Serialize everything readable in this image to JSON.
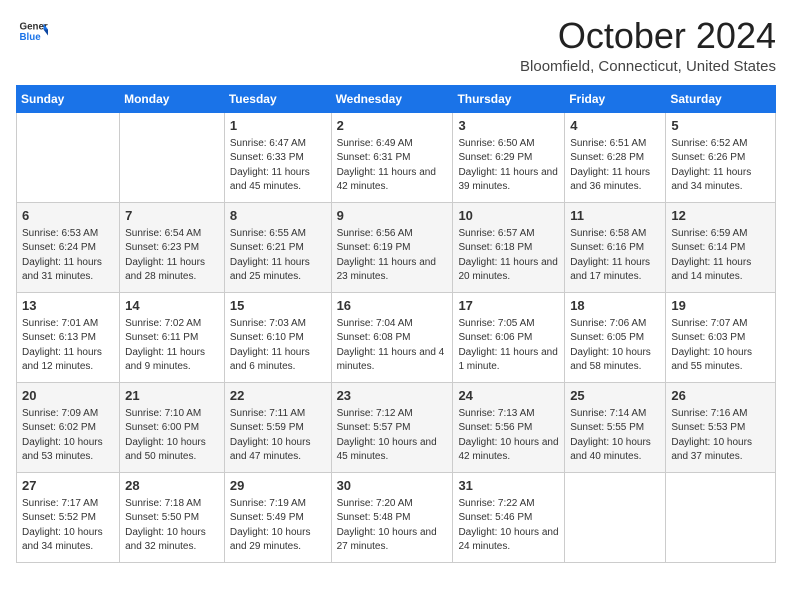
{
  "header": {
    "logo_general": "General",
    "logo_blue": "Blue",
    "month_title": "October 2024",
    "location": "Bloomfield, Connecticut, United States"
  },
  "days_of_week": [
    "Sunday",
    "Monday",
    "Tuesday",
    "Wednesday",
    "Thursday",
    "Friday",
    "Saturday"
  ],
  "weeks": [
    [
      {
        "day": "",
        "info": ""
      },
      {
        "day": "",
        "info": ""
      },
      {
        "day": "1",
        "info": "Sunrise: 6:47 AM\nSunset: 6:33 PM\nDaylight: 11 hours and 45 minutes."
      },
      {
        "day": "2",
        "info": "Sunrise: 6:49 AM\nSunset: 6:31 PM\nDaylight: 11 hours and 42 minutes."
      },
      {
        "day": "3",
        "info": "Sunrise: 6:50 AM\nSunset: 6:29 PM\nDaylight: 11 hours and 39 minutes."
      },
      {
        "day": "4",
        "info": "Sunrise: 6:51 AM\nSunset: 6:28 PM\nDaylight: 11 hours and 36 minutes."
      },
      {
        "day": "5",
        "info": "Sunrise: 6:52 AM\nSunset: 6:26 PM\nDaylight: 11 hours and 34 minutes."
      }
    ],
    [
      {
        "day": "6",
        "info": "Sunrise: 6:53 AM\nSunset: 6:24 PM\nDaylight: 11 hours and 31 minutes."
      },
      {
        "day": "7",
        "info": "Sunrise: 6:54 AM\nSunset: 6:23 PM\nDaylight: 11 hours and 28 minutes."
      },
      {
        "day": "8",
        "info": "Sunrise: 6:55 AM\nSunset: 6:21 PM\nDaylight: 11 hours and 25 minutes."
      },
      {
        "day": "9",
        "info": "Sunrise: 6:56 AM\nSunset: 6:19 PM\nDaylight: 11 hours and 23 minutes."
      },
      {
        "day": "10",
        "info": "Sunrise: 6:57 AM\nSunset: 6:18 PM\nDaylight: 11 hours and 20 minutes."
      },
      {
        "day": "11",
        "info": "Sunrise: 6:58 AM\nSunset: 6:16 PM\nDaylight: 11 hours and 17 minutes."
      },
      {
        "day": "12",
        "info": "Sunrise: 6:59 AM\nSunset: 6:14 PM\nDaylight: 11 hours and 14 minutes."
      }
    ],
    [
      {
        "day": "13",
        "info": "Sunrise: 7:01 AM\nSunset: 6:13 PM\nDaylight: 11 hours and 12 minutes."
      },
      {
        "day": "14",
        "info": "Sunrise: 7:02 AM\nSunset: 6:11 PM\nDaylight: 11 hours and 9 minutes."
      },
      {
        "day": "15",
        "info": "Sunrise: 7:03 AM\nSunset: 6:10 PM\nDaylight: 11 hours and 6 minutes."
      },
      {
        "day": "16",
        "info": "Sunrise: 7:04 AM\nSunset: 6:08 PM\nDaylight: 11 hours and 4 minutes."
      },
      {
        "day": "17",
        "info": "Sunrise: 7:05 AM\nSunset: 6:06 PM\nDaylight: 11 hours and 1 minute."
      },
      {
        "day": "18",
        "info": "Sunrise: 7:06 AM\nSunset: 6:05 PM\nDaylight: 10 hours and 58 minutes."
      },
      {
        "day": "19",
        "info": "Sunrise: 7:07 AM\nSunset: 6:03 PM\nDaylight: 10 hours and 55 minutes."
      }
    ],
    [
      {
        "day": "20",
        "info": "Sunrise: 7:09 AM\nSunset: 6:02 PM\nDaylight: 10 hours and 53 minutes."
      },
      {
        "day": "21",
        "info": "Sunrise: 7:10 AM\nSunset: 6:00 PM\nDaylight: 10 hours and 50 minutes."
      },
      {
        "day": "22",
        "info": "Sunrise: 7:11 AM\nSunset: 5:59 PM\nDaylight: 10 hours and 47 minutes."
      },
      {
        "day": "23",
        "info": "Sunrise: 7:12 AM\nSunset: 5:57 PM\nDaylight: 10 hours and 45 minutes."
      },
      {
        "day": "24",
        "info": "Sunrise: 7:13 AM\nSunset: 5:56 PM\nDaylight: 10 hours and 42 minutes."
      },
      {
        "day": "25",
        "info": "Sunrise: 7:14 AM\nSunset: 5:55 PM\nDaylight: 10 hours and 40 minutes."
      },
      {
        "day": "26",
        "info": "Sunrise: 7:16 AM\nSunset: 5:53 PM\nDaylight: 10 hours and 37 minutes."
      }
    ],
    [
      {
        "day": "27",
        "info": "Sunrise: 7:17 AM\nSunset: 5:52 PM\nDaylight: 10 hours and 34 minutes."
      },
      {
        "day": "28",
        "info": "Sunrise: 7:18 AM\nSunset: 5:50 PM\nDaylight: 10 hours and 32 minutes."
      },
      {
        "day": "29",
        "info": "Sunrise: 7:19 AM\nSunset: 5:49 PM\nDaylight: 10 hours and 29 minutes."
      },
      {
        "day": "30",
        "info": "Sunrise: 7:20 AM\nSunset: 5:48 PM\nDaylight: 10 hours and 27 minutes."
      },
      {
        "day": "31",
        "info": "Sunrise: 7:22 AM\nSunset: 5:46 PM\nDaylight: 10 hours and 24 minutes."
      },
      {
        "day": "",
        "info": ""
      },
      {
        "day": "",
        "info": ""
      }
    ]
  ]
}
